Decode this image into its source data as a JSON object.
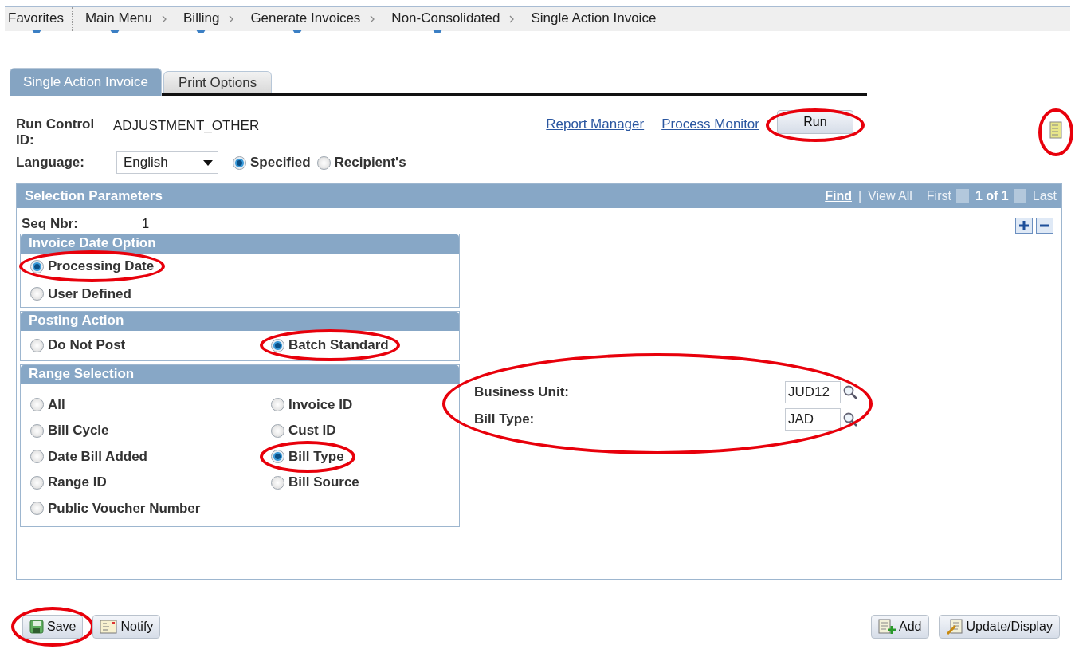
{
  "breadcrumbs": [
    {
      "label": "Favorites",
      "menu": true
    },
    {
      "label": "Main Menu",
      "menu": true
    },
    {
      "label": "Billing",
      "menu": true
    },
    {
      "label": "Generate Invoices",
      "menu": true
    },
    {
      "label": "Non-Consolidated",
      "menu": true
    },
    {
      "label": "Single Action Invoice",
      "menu": false
    }
  ],
  "tabs": [
    {
      "label": "Single Action Invoice",
      "selected": true
    },
    {
      "label": "Print Options",
      "selected": false
    }
  ],
  "run_control": {
    "label": "Run Control ID:",
    "value": "ADJUSTMENT_OTHER"
  },
  "links": [
    "Report Manager",
    "Process Monitor"
  ],
  "run_button": {
    "label": "Run",
    "circled": true
  },
  "notes_icon": {
    "circled": true
  },
  "language": {
    "label": "Language:",
    "value": "English",
    "options": [
      {
        "label": "Specified",
        "selected": true
      },
      {
        "label": "Recipient's",
        "selected": false
      }
    ]
  },
  "selection": {
    "title": "Selection Parameters",
    "find": "Find",
    "separator": "|",
    "view_all": "View All",
    "first": "First",
    "count": "1 of 1",
    "last": "Last",
    "seq_label": "Seq Nbr:",
    "seq_value": "1",
    "groups": [
      {
        "title": "Invoice Date Option",
        "kind": "stack",
        "options": [
          {
            "label": "Processing Date",
            "selected": true,
            "circled": true
          },
          {
            "label": "User Defined",
            "selected": false,
            "circled": false
          }
        ]
      },
      {
        "title": "Posting Action",
        "kind": "grid",
        "options": [
          {
            "label": "Do Not Post",
            "selected": false,
            "circled": false
          },
          {
            "label": "Batch Standard",
            "selected": true,
            "circled": true
          }
        ]
      },
      {
        "title": "Range Selection",
        "kind": "grid",
        "options": [
          {
            "label": "All",
            "selected": false,
            "circled": false
          },
          {
            "label": "Invoice ID",
            "selected": false,
            "circled": false
          },
          {
            "label": "Bill Cycle",
            "selected": false,
            "circled": false
          },
          {
            "label": "Cust ID",
            "selected": false,
            "circled": false
          },
          {
            "label": "Date Bill Added",
            "selected": false,
            "circled": false
          },
          {
            "label": "Bill Type",
            "selected": true,
            "circled": true
          },
          {
            "label": "Range ID",
            "selected": false,
            "circled": false
          },
          {
            "label": "Bill Source",
            "selected": false,
            "circled": false
          },
          {
            "label": "Public Voucher Number",
            "selected": false,
            "circled": false
          }
        ]
      }
    ],
    "criteria": {
      "circled": true,
      "fields": [
        {
          "label": "Business Unit:",
          "value": "JUD12"
        },
        {
          "label": "Bill Type:",
          "value": "JAD"
        }
      ]
    }
  },
  "footer": {
    "left": [
      {
        "kind": "save",
        "label": "Save",
        "circled": true
      },
      {
        "kind": "notify",
        "label": "Notify",
        "circled": false
      }
    ],
    "right": [
      {
        "kind": "add",
        "label": "Add",
        "circled": false
      },
      {
        "kind": "update",
        "label": "Update/Display",
        "circled": false
      }
    ]
  }
}
